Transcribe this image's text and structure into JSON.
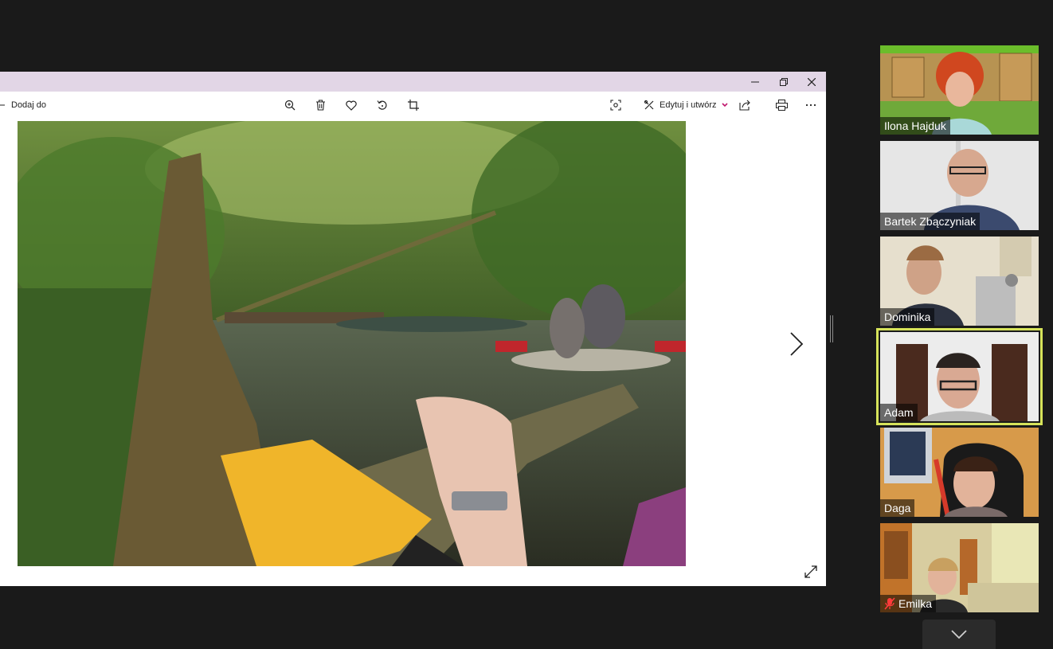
{
  "photos_app": {
    "window_controls": {
      "minimize_icon": "minimize-icon",
      "restore_icon": "restore-icon",
      "close_icon": "close-icon"
    },
    "toolbar": {
      "add_to_label": "Dodaj do",
      "edit_create_label": "Edytuj i utwórz",
      "icons": [
        "zoom-in-icon",
        "delete-icon",
        "favorite-icon",
        "rotate-icon",
        "crop-icon",
        "visual-search-icon",
        "share-icon",
        "print-icon",
        "more-icon"
      ]
    },
    "photo": {
      "subject": "people kayaking on a forest river, hand on a mossy log holding a yellow paddle"
    },
    "next_icon": "chevron-right-icon",
    "expand_icon": "expand-icon"
  },
  "gallery": {
    "participants": [
      {
        "name": "Ilona Hajduk",
        "muted": false,
        "active": false
      },
      {
        "name": "Bartek Zbączyniak",
        "muted": false,
        "active": false
      },
      {
        "name": "Dominika",
        "muted": false,
        "active": false
      },
      {
        "name": "Adam",
        "muted": false,
        "active": true
      },
      {
        "name": "Daga",
        "muted": false,
        "active": false
      },
      {
        "name": "Emilka",
        "muted": true,
        "active": false
      }
    ],
    "active_color": "#d6e35a",
    "scroll_icon": "chevron-down-icon"
  }
}
